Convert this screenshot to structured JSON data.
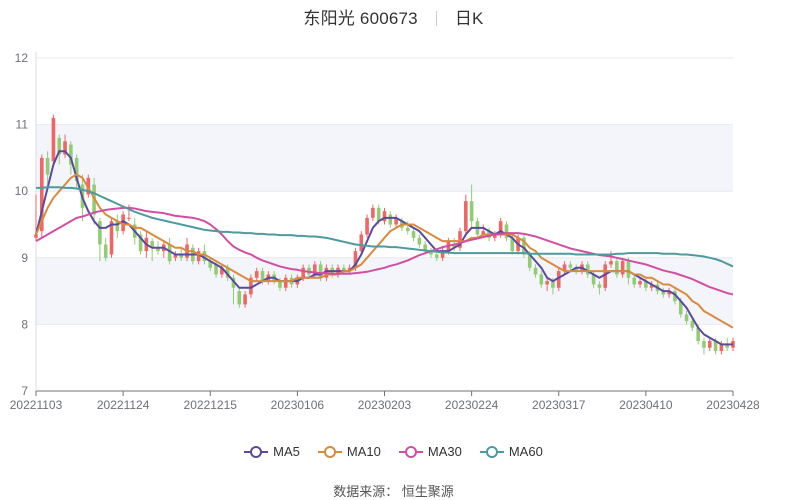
{
  "title": {
    "stock_name": "东阳光 600673",
    "period": "日K"
  },
  "source_text": "数据来源：  恒生聚源",
  "colors": {
    "up": "#ee6666",
    "down": "#91cc75",
    "band": "#f3f5fb",
    "grid": "#e6e9f0",
    "axis": "#6e7079"
  },
  "chart_data": {
    "type": "candlestick",
    "y_axis": {
      "min": 7,
      "max": 12,
      "ticks": [
        7,
        8,
        9,
        10,
        11,
        12
      ]
    },
    "x_axis": {
      "tick_labels": [
        "20221103",
        "20221124",
        "20221215",
        "20230106",
        "20230203",
        "20230224",
        "20230317",
        "20230410",
        "20230428"
      ],
      "tick_index": [
        0,
        15,
        30,
        45,
        60,
        75,
        90,
        105,
        120
      ]
    },
    "legend": [
      {
        "name": "MA5",
        "color": "#5b4a9c"
      },
      {
        "name": "MA10",
        "color": "#d98a3d"
      },
      {
        "name": "MA30",
        "color": "#d14fa3"
      },
      {
        "name": "MA60",
        "color": "#4d9a9f"
      }
    ],
    "candles": [
      [
        9.3,
        9.35,
        9.25,
        9.95
      ],
      [
        9.4,
        10.5,
        9.3,
        10.55
      ],
      [
        10.5,
        10.25,
        10.1,
        10.6
      ],
      [
        10.45,
        11.1,
        10.4,
        11.15
      ],
      [
        10.8,
        10.55,
        10.4,
        10.85
      ],
      [
        10.55,
        10.75,
        10.5,
        10.85
      ],
      [
        10.7,
        10.4,
        10.25,
        10.75
      ],
      [
        10.5,
        10.15,
        10.05,
        10.55
      ],
      [
        10.1,
        9.75,
        9.55,
        10.25
      ],
      [
        9.95,
        10.2,
        9.9,
        10.25
      ],
      [
        10.1,
        9.65,
        9.5,
        10.2
      ],
      [
        9.55,
        9.2,
        8.95,
        9.6
      ],
      [
        9.2,
        9.0,
        8.95,
        9.3
      ],
      [
        9.05,
        9.55,
        9.0,
        9.6
      ],
      [
        9.55,
        9.4,
        9.3,
        9.65
      ],
      [
        9.4,
        9.65,
        9.35,
        9.7
      ],
      [
        9.6,
        9.6,
        9.55,
        9.8
      ],
      [
        9.5,
        9.3,
        9.2,
        9.6
      ],
      [
        9.35,
        9.1,
        9.05,
        9.4
      ],
      [
        9.1,
        9.3,
        9.0,
        9.4
      ],
      [
        9.25,
        9.15,
        8.95,
        9.3
      ],
      [
        9.15,
        9.1,
        9.05,
        9.25
      ],
      [
        9.1,
        9.2,
        9.0,
        9.25
      ],
      [
        9.2,
        8.95,
        8.9,
        9.3
      ],
      [
        9.0,
        9.05,
        8.95,
        9.1
      ],
      [
        9.05,
        9.0,
        8.95,
        9.15
      ],
      [
        9.0,
        9.2,
        8.95,
        9.3
      ],
      [
        9.15,
        8.95,
        8.9,
        9.2
      ],
      [
        8.95,
        9.1,
        8.9,
        9.15
      ],
      [
        9.1,
        8.95,
        8.9,
        9.2
      ],
      [
        8.95,
        8.85,
        8.8,
        9.0
      ],
      [
        8.9,
        8.75,
        8.7,
        8.95
      ],
      [
        8.75,
        8.85,
        8.7,
        8.9
      ],
      [
        8.85,
        8.7,
        8.65,
        8.9
      ],
      [
        8.7,
        8.55,
        8.3,
        8.75
      ],
      [
        8.5,
        8.3,
        8.25,
        8.55
      ],
      [
        8.3,
        8.45,
        8.25,
        8.5
      ],
      [
        8.45,
        8.7,
        8.4,
        8.75
      ],
      [
        8.7,
        8.8,
        8.65,
        8.85
      ],
      [
        8.8,
        8.65,
        8.6,
        8.85
      ],
      [
        8.65,
        8.75,
        8.6,
        8.8
      ],
      [
        8.75,
        8.65,
        8.6,
        8.8
      ],
      [
        8.65,
        8.55,
        8.5,
        8.7
      ],
      [
        8.55,
        8.7,
        8.5,
        8.75
      ],
      [
        8.7,
        8.6,
        8.55,
        8.75
      ],
      [
        8.6,
        8.7,
        8.55,
        8.75
      ],
      [
        8.7,
        8.85,
        8.65,
        8.9
      ],
      [
        8.85,
        8.75,
        8.7,
        8.9
      ],
      [
        8.75,
        8.9,
        8.7,
        8.95
      ],
      [
        8.9,
        8.7,
        8.65,
        8.95
      ],
      [
        8.7,
        8.85,
        8.65,
        8.9
      ],
      [
        8.85,
        8.75,
        8.7,
        8.9
      ],
      [
        8.75,
        8.85,
        8.7,
        8.9
      ],
      [
        8.85,
        8.8,
        8.75,
        8.9
      ],
      [
        8.8,
        8.85,
        8.75,
        8.9
      ],
      [
        8.85,
        9.1,
        8.8,
        9.15
      ],
      [
        9.1,
        9.35,
        9.05,
        9.4
      ],
      [
        9.35,
        9.6,
        9.3,
        9.65
      ],
      [
        9.6,
        9.75,
        9.55,
        9.8
      ],
      [
        9.75,
        9.55,
        9.5,
        9.8
      ],
      [
        9.55,
        9.7,
        9.5,
        9.75
      ],
      [
        9.65,
        9.5,
        9.45,
        9.7
      ],
      [
        9.5,
        9.6,
        9.45,
        9.65
      ],
      [
        9.55,
        9.45,
        9.4,
        9.6
      ],
      [
        9.45,
        9.4,
        9.35,
        9.55
      ],
      [
        9.4,
        9.3,
        9.25,
        9.45
      ],
      [
        9.3,
        9.2,
        9.15,
        9.35
      ],
      [
        9.2,
        9.1,
        9.05,
        9.25
      ],
      [
        9.1,
        9.05,
        9.0,
        9.15
      ],
      [
        9.05,
        9.0,
        8.95,
        9.1
      ],
      [
        9.0,
        9.1,
        8.95,
        9.15
      ],
      [
        9.1,
        9.25,
        9.05,
        9.3
      ],
      [
        9.2,
        9.15,
        9.1,
        9.3
      ],
      [
        9.15,
        9.4,
        9.1,
        9.45
      ],
      [
        9.4,
        9.85,
        9.35,
        9.95
      ],
      [
        9.85,
        9.55,
        9.45,
        10.1
      ],
      [
        9.55,
        9.35,
        9.3,
        9.6
      ],
      [
        9.35,
        9.4,
        9.3,
        9.5
      ],
      [
        9.4,
        9.3,
        9.25,
        9.45
      ],
      [
        9.3,
        9.35,
        9.25,
        9.4
      ],
      [
        9.35,
        9.55,
        9.3,
        9.6
      ],
      [
        9.5,
        9.3,
        9.25,
        9.55
      ],
      [
        9.3,
        9.1,
        9.05,
        9.35
      ],
      [
        9.1,
        9.3,
        9.05,
        9.35
      ],
      [
        9.3,
        9.05,
        9.0,
        9.35
      ],
      [
        9.05,
        8.85,
        8.8,
        9.1
      ],
      [
        8.85,
        8.75,
        8.7,
        8.9
      ],
      [
        8.75,
        8.6,
        8.55,
        8.8
      ],
      [
        8.6,
        8.65,
        8.5,
        8.7
      ],
      [
        8.65,
        8.55,
        8.45,
        8.7
      ],
      [
        8.55,
        8.8,
        8.5,
        8.85
      ],
      [
        8.8,
        8.9,
        8.75,
        8.95
      ],
      [
        8.9,
        8.85,
        8.8,
        8.95
      ],
      [
        8.85,
        8.8,
        8.75,
        8.9
      ],
      [
        8.8,
        8.9,
        8.75,
        8.95
      ],
      [
        8.9,
        8.75,
        8.7,
        8.95
      ],
      [
        8.75,
        8.6,
        8.55,
        8.8
      ],
      [
        8.6,
        8.55,
        8.45,
        8.65
      ],
      [
        8.55,
        8.9,
        8.5,
        8.95
      ],
      [
        8.9,
        8.95,
        8.85,
        9.1
      ],
      [
        8.95,
        8.75,
        8.7,
        9.0
      ],
      [
        8.75,
        8.95,
        8.7,
        9.0
      ],
      [
        8.95,
        8.7,
        8.6,
        9.0
      ],
      [
        8.7,
        8.6,
        8.55,
        8.75
      ],
      [
        8.6,
        8.65,
        8.55,
        8.7
      ],
      [
        8.65,
        8.55,
        8.5,
        8.7
      ],
      [
        8.55,
        8.6,
        8.5,
        8.65
      ],
      [
        8.6,
        8.5,
        8.45,
        8.65
      ],
      [
        8.5,
        8.45,
        8.4,
        8.55
      ],
      [
        8.45,
        8.5,
        8.4,
        8.55
      ],
      [
        8.5,
        8.35,
        8.3,
        8.55
      ],
      [
        8.35,
        8.15,
        8.1,
        8.4
      ],
      [
        8.15,
        8.05,
        8.0,
        8.2
      ],
      [
        8.05,
        7.95,
        7.9,
        8.1
      ],
      [
        7.95,
        7.75,
        7.7,
        8.0
      ],
      [
        7.75,
        7.65,
        7.55,
        7.8
      ],
      [
        7.65,
        7.75,
        7.6,
        7.8
      ],
      [
        7.75,
        7.6,
        7.55,
        7.8
      ],
      [
        7.6,
        7.7,
        7.55,
        7.75
      ],
      [
        7.7,
        7.65,
        7.6,
        7.8
      ],
      [
        7.65,
        7.75,
        7.6,
        7.8
      ]
    ],
    "series": [
      {
        "name": "MA5",
        "values": [
          9.35,
          9.7,
          10.05,
          10.4,
          10.6,
          10.6,
          10.5,
          10.2,
          9.9,
          9.7,
          9.55,
          9.45,
          9.45,
          9.5,
          9.5,
          9.55,
          9.5,
          9.4,
          9.3,
          9.2,
          9.15,
          9.15,
          9.15,
          9.1,
          9.05,
          9.05,
          9.05,
          9.05,
          9.05,
          9.0,
          8.95,
          8.9,
          8.85,
          8.75,
          8.65,
          8.55,
          8.55,
          8.55,
          8.6,
          8.65,
          8.7,
          8.7,
          8.65,
          8.65,
          8.65,
          8.65,
          8.7,
          8.7,
          8.75,
          8.75,
          8.8,
          8.8,
          8.8,
          8.8,
          8.8,
          8.9,
          9.05,
          9.25,
          9.45,
          9.55,
          9.6,
          9.6,
          9.6,
          9.55,
          9.5,
          9.45,
          9.4,
          9.3,
          9.2,
          9.1,
          9.1,
          9.1,
          9.15,
          9.2,
          9.35,
          9.45,
          9.45,
          9.45,
          9.4,
          9.35,
          9.4,
          9.35,
          9.3,
          9.2,
          9.15,
          9.05,
          8.95,
          8.85,
          8.7,
          8.65,
          8.7,
          8.75,
          8.8,
          8.85,
          8.85,
          8.8,
          8.75,
          8.7,
          8.75,
          8.8,
          8.8,
          8.8,
          8.8,
          8.75,
          8.7,
          8.65,
          8.6,
          8.55,
          8.5,
          8.5,
          8.45,
          8.35,
          8.25,
          8.1,
          7.95,
          7.85,
          7.8,
          7.75,
          7.7,
          7.7,
          7.7
        ]
      },
      {
        "name": "MA10",
        "values": [
          9.35,
          9.55,
          9.75,
          9.9,
          10.0,
          10.1,
          10.2,
          10.25,
          10.2,
          10.05,
          9.9,
          9.75,
          9.65,
          9.6,
          9.55,
          9.5,
          9.5,
          9.45,
          9.45,
          9.4,
          9.35,
          9.3,
          9.25,
          9.2,
          9.15,
          9.15,
          9.1,
          9.1,
          9.05,
          9.05,
          9.0,
          8.95,
          8.9,
          8.85,
          8.8,
          8.75,
          8.7,
          8.65,
          8.65,
          8.65,
          8.65,
          8.65,
          8.65,
          8.65,
          8.65,
          8.7,
          8.7,
          8.7,
          8.7,
          8.7,
          8.75,
          8.75,
          8.75,
          8.8,
          8.8,
          8.85,
          8.9,
          9.0,
          9.1,
          9.2,
          9.3,
          9.4,
          9.45,
          9.5,
          9.5,
          9.5,
          9.45,
          9.4,
          9.35,
          9.3,
          9.25,
          9.25,
          9.25,
          9.25,
          9.25,
          9.3,
          9.3,
          9.35,
          9.35,
          9.35,
          9.35,
          9.35,
          9.35,
          9.3,
          9.25,
          9.15,
          9.1,
          9.0,
          8.95,
          8.9,
          8.85,
          8.8,
          8.8,
          8.8,
          8.8,
          8.8,
          8.8,
          8.8,
          8.8,
          8.8,
          8.8,
          8.8,
          8.8,
          8.75,
          8.75,
          8.7,
          8.7,
          8.65,
          8.6,
          8.6,
          8.55,
          8.5,
          8.45,
          8.35,
          8.3,
          8.2,
          8.15,
          8.1,
          8.05,
          8.0,
          7.95
        ]
      },
      {
        "name": "MA30",
        "values": [
          9.25,
          9.3,
          9.35,
          9.4,
          9.45,
          9.5,
          9.55,
          9.6,
          9.62,
          9.65,
          9.68,
          9.7,
          9.72,
          9.73,
          9.74,
          9.75,
          9.75,
          9.74,
          9.72,
          9.7,
          9.69,
          9.68,
          9.67,
          9.65,
          9.63,
          9.62,
          9.61,
          9.6,
          9.58,
          9.55,
          9.5,
          9.43,
          9.35,
          9.25,
          9.17,
          9.12,
          9.08,
          9.05,
          9.0,
          8.96,
          8.93,
          8.9,
          8.87,
          8.85,
          8.83,
          8.82,
          8.8,
          8.79,
          8.78,
          8.77,
          8.77,
          8.76,
          8.76,
          8.76,
          8.76,
          8.77,
          8.78,
          8.79,
          8.81,
          8.83,
          8.85,
          8.88,
          8.9,
          8.93,
          8.96,
          9.0,
          9.04,
          9.07,
          9.1,
          9.13,
          9.16,
          9.18,
          9.2,
          9.22,
          9.25,
          9.27,
          9.29,
          9.31,
          9.33,
          9.35,
          9.36,
          9.37,
          9.37,
          9.37,
          9.36,
          9.34,
          9.32,
          9.29,
          9.26,
          9.23,
          9.2,
          9.17,
          9.14,
          9.12,
          9.1,
          9.08,
          9.06,
          9.04,
          9.03,
          9.02,
          9.0,
          8.98,
          8.96,
          8.94,
          8.92,
          8.9,
          8.87,
          8.84,
          8.81,
          8.79,
          8.77,
          8.74,
          8.71,
          8.68,
          8.64,
          8.6,
          8.56,
          8.53,
          8.5,
          8.47,
          8.45
        ]
      },
      {
        "name": "MA60",
        "values": [
          10.05,
          10.05,
          10.06,
          10.06,
          10.06,
          10.05,
          10.05,
          10.04,
          10.02,
          10.0,
          9.97,
          9.93,
          9.89,
          9.85,
          9.81,
          9.77,
          9.73,
          9.69,
          9.66,
          9.63,
          9.6,
          9.58,
          9.56,
          9.54,
          9.52,
          9.5,
          9.48,
          9.46,
          9.44,
          9.42,
          9.41,
          9.4,
          9.39,
          9.39,
          9.38,
          9.38,
          9.37,
          9.37,
          9.36,
          9.36,
          9.35,
          9.35,
          9.34,
          9.34,
          9.34,
          9.33,
          9.33,
          9.32,
          9.32,
          9.31,
          9.3,
          9.28,
          9.26,
          9.24,
          9.22,
          9.2,
          9.19,
          9.18,
          9.17,
          9.17,
          9.17,
          9.16,
          9.16,
          9.15,
          9.14,
          9.13,
          9.12,
          9.11,
          9.1,
          9.09,
          9.08,
          9.08,
          9.07,
          9.07,
          9.07,
          9.07,
          9.07,
          9.07,
          9.07,
          9.07,
          9.07,
          9.07,
          9.07,
          9.07,
          9.07,
          9.06,
          9.06,
          9.06,
          9.06,
          9.06,
          9.06,
          9.06,
          9.06,
          9.05,
          9.05,
          9.05,
          9.05,
          9.05,
          9.05,
          9.05,
          9.06,
          9.06,
          9.07,
          9.07,
          9.07,
          9.07,
          9.07,
          9.07,
          9.06,
          9.06,
          9.06,
          9.05,
          9.05,
          9.04,
          9.03,
          9.02,
          9.0,
          8.98,
          8.95,
          8.91,
          8.87
        ]
      }
    ]
  }
}
